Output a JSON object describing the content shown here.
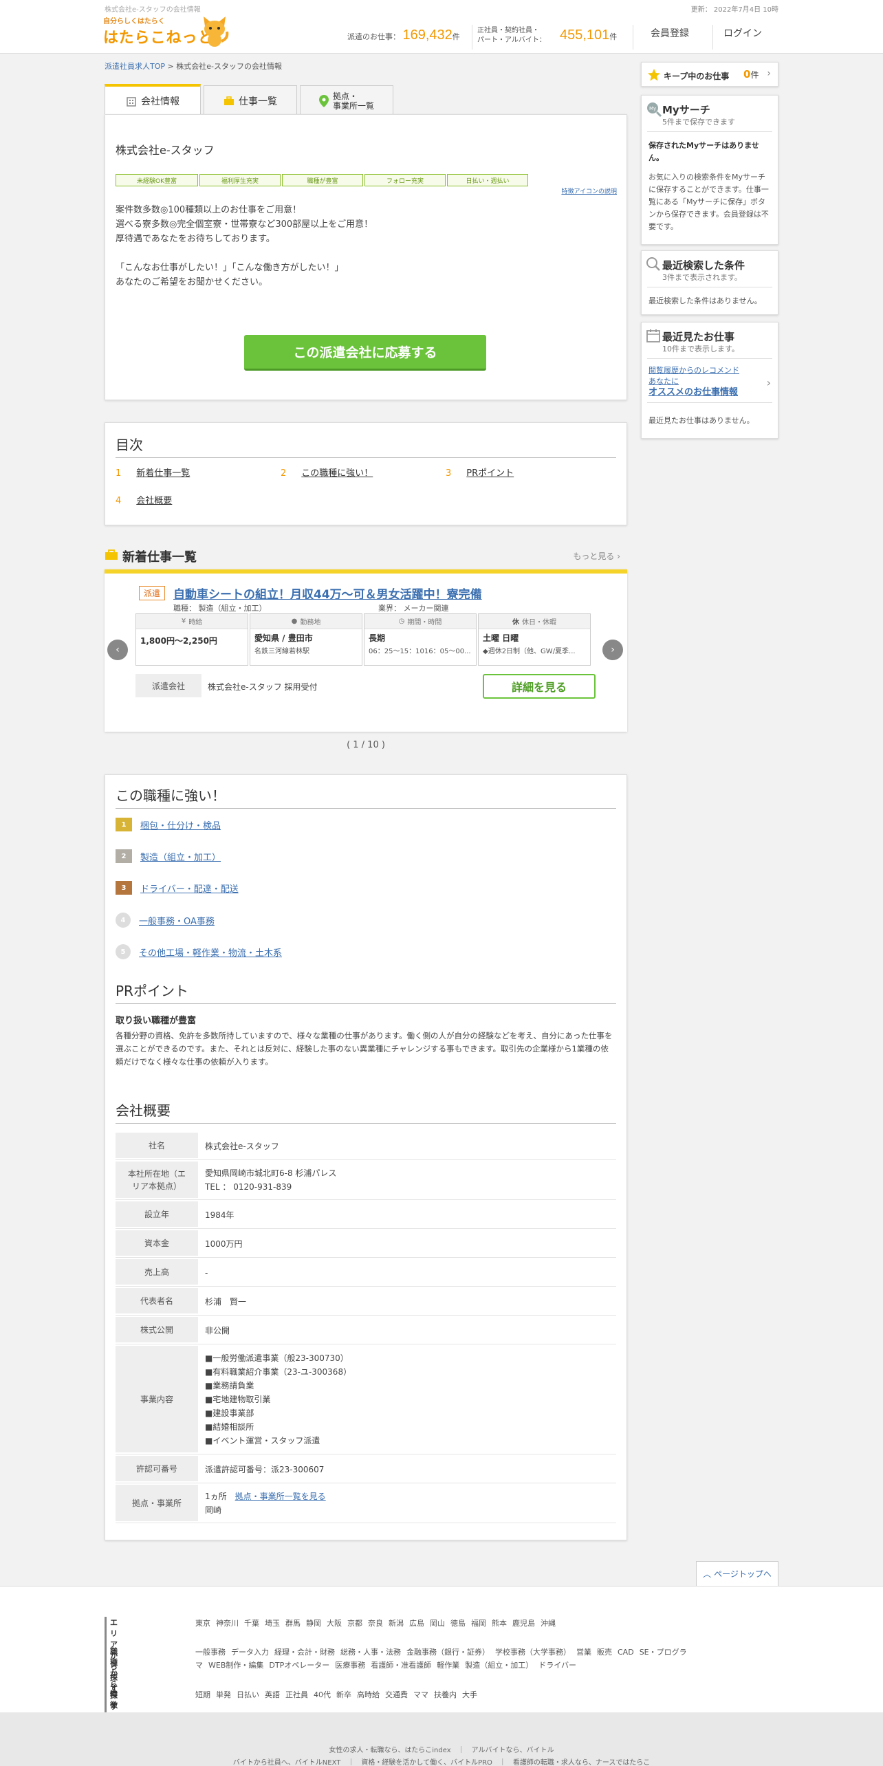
{
  "header": {
    "tagline": "株式会社e-スタッフの会社情報",
    "updated": "更新： 2022年7月4日 10時",
    "logo_small": "自分らしくはたらく",
    "logo_main": "はたらこねっと",
    "haken_label": "派遣のお仕事：",
    "haken_count": "169,432",
    "haken_unit": "件",
    "other_label1": "正社員・契約社員・",
    "other_label2": "パート・アルバイト：",
    "other_count": "455,101",
    "other_unit": "件",
    "register": "会員登録",
    "login": "ログイン"
  },
  "breadcrumb": {
    "home": "派遣社員求人TOP",
    "sep": " > ",
    "company": "株式会社e-スタッフの会社情報"
  },
  "tabs": {
    "company_info": "会社情報",
    "jobs": "仕事一覧",
    "locations_1": "拠点・",
    "locations_2": "事業所一覧"
  },
  "company": {
    "name": "株式会社e-スタッフ",
    "badges": [
      "未経験OK豊富",
      "福利厚生充実",
      "職種が豊富",
      "フォロー充実",
      "日払い・週払い"
    ],
    "badge_help": "特徴アイコンの説明",
    "intro": [
      "案件数多数◎100種類以上のお仕事をご用意！",
      "選べる寮多数◎完全個室寮・世帯寮など300部屋以上をご用意！",
      "厚待遇であなたをお待ちしております。",
      "",
      "「こんなお仕事がしたい！」「こんな働き方がしたい！」",
      "あなたのご希望をお聞かせください。"
    ],
    "apply": "この派遣会社に応募する"
  },
  "toc": {
    "title": "目次",
    "items": [
      {
        "num": "1",
        "label": "新着仕事一覧"
      },
      {
        "num": "2",
        "label": "この職種に強い！"
      },
      {
        "num": "3",
        "label": "PRポイント"
      },
      {
        "num": "4",
        "label": "会社概要"
      }
    ]
  },
  "new_jobs": {
    "title": "新着仕事一覧",
    "more": "もっと見る",
    "tag": "派遣",
    "job_title": "自動車シートの組立！月収44万～可＆男女活躍中！寮完備",
    "category": "職種： 製造（組立・加工）",
    "industry": "業界： メーカー関連",
    "cells": [
      {
        "head": "時給",
        "main": "1,800円～2,250円",
        "sub": ""
      },
      {
        "head": "勤務地",
        "main": "愛知県 / 豊田市",
        "sub": "名鉄三河線若林駅"
      },
      {
        "head": "期間・時間",
        "main": "長期",
        "sub": "06：25～15：1016：05～00..."
      },
      {
        "head": "休日・休暇",
        "main": "土曜 日曜",
        "sub": "◆週休2日制（他、GW/夏季..."
      }
    ],
    "agency_label": "派遣会社",
    "agency_name": "株式会社e-スタッフ 採用受付",
    "detail": "詳細を見る",
    "pager": "( 1 / 10 )"
  },
  "strong": {
    "title": "この職種に強い！",
    "items": [
      {
        "rank": "1",
        "label": "梱包・仕分け・検品"
      },
      {
        "rank": "2",
        "label": "製造（組立・加工）"
      },
      {
        "rank": "3",
        "label": "ドライバー・配達・配送"
      },
      {
        "rank": "4",
        "label": "一般事務・OA事務"
      },
      {
        "rank": "5",
        "label": "その他工場・軽作業・物流・土木系"
      }
    ]
  },
  "pr": {
    "title": "PRポイント",
    "subtitle": "取り扱い職種が豊富",
    "text": "各種分野の資格、免許を多数所持していますので、様々な業種の仕事があります。働く側の人が自分の経験などを考え、自分にあった仕事を選ぶことができるのです。また、それとは反対に、経験した事のない異業種にチャレンジする事もできます。取引先の企業様から1業種の依頼だけでなく様々な仕事の依頼が入ります。"
  },
  "overview": {
    "title": "会社概要",
    "rows": [
      {
        "label": "社名",
        "value": [
          "株式会社e-スタッフ"
        ]
      },
      {
        "label": "本社所在地（エリア本拠点）",
        "value": [
          "愛知県岡崎市城北町6-8 杉浦パレス",
          "TEL ： 0120-931-839"
        ]
      },
      {
        "label": "設立年",
        "value": [
          "1984年"
        ]
      },
      {
        "label": "資本金",
        "value": [
          "1000万円"
        ]
      },
      {
        "label": "売上高",
        "value": [
          "-"
        ]
      },
      {
        "label": "代表者名",
        "value": [
          "杉浦　賢一"
        ]
      },
      {
        "label": "株式公開",
        "value": [
          "非公開"
        ]
      },
      {
        "label": "事業内容",
        "value": [
          "■一般労働派遣事業（般23-300730）",
          "■有料職業紹介事業（23-ユ-300368）",
          "■業務請負業",
          "■宅地建物取引業",
          "■建設事業部",
          "■結婚相談所",
          "■イベント運営・スタッフ派遣"
        ]
      },
      {
        "label": "許認可番号",
        "value": [
          "派遣許認可番号：派23-300607"
        ]
      },
      {
        "label": "拠点・事業所",
        "value": [
          "1ヵ所",
          "岡崎"
        ],
        "link": "拠点・事業所一覧を見る"
      }
    ]
  },
  "sidebar": {
    "keep_label": "キープ中のお仕事",
    "keep_count": "0",
    "keep_unit": "件",
    "mysearch_title": "Myサーチ",
    "mysearch_sub": "5件まで保存できます",
    "mysearch_empty": "保存されたMyサーチはありません。",
    "mysearch_desc": "お気に入りの検索条件をMyサーチに保存することができます。仕事一覧にある「Myサーチに保存」ボタンから保存できます。会員登録は不要です。",
    "recent_search_title": "最近検索した条件",
    "recent_search_sub": "3件まで表示されます。",
    "recent_search_empty": "最近検索した条件はありません。",
    "recent_jobs_title": "最近見たお仕事",
    "recent_jobs_sub": "10件まで表示します。",
    "recommend_1": "閲覧履歴からのレコメンド",
    "recommend_2": "あなたに",
    "recommend_3": "オススメのお仕事情報",
    "recent_jobs_empty": "最近見たお仕事はありません。"
  },
  "pagetop": "ページトップへ",
  "footer": {
    "area_label": "エリアから探す",
    "areas": [
      "東京",
      "神奈川",
      "千葉",
      "埼玉",
      "群馬",
      "静岡",
      "大阪",
      "京都",
      "奈良",
      "新潟",
      "広島",
      "岡山",
      "徳島",
      "福岡",
      "熊本",
      "鹿児島",
      "沖縄"
    ],
    "job_label": "職種から探す",
    "jobs": [
      "一般事務",
      "データ入力",
      "経理・会計・財務",
      "総務・人事・法務",
      "金融事務（銀行・証券）",
      "学校事務（大学事務）",
      "営業",
      "販売",
      "CAD",
      "SE・プログラマ",
      "WEB制作・編集",
      "DTPオペレーター",
      "医療事務",
      "看護師・准看護師",
      "軽作業",
      "製造（組立・加工）",
      "ドライバー"
    ],
    "feature_label": "特徴から探す",
    "features": [
      "短期",
      "単発",
      "日払い",
      "英語",
      "正社員",
      "40代",
      "新卒",
      "高時給",
      "交通費",
      "ママ",
      "扶養内",
      "大手"
    ],
    "bottom_1": "女性の求人・転職なら、はたらこindex　｜　アルバイトなら、バイトル",
    "bottom_2": "バイトから社員へ、バイトルNEXT　｜　資格・経験を活かして働く、バイトルPRO　｜　看護師の転職・求人なら、ナースではたらこ"
  },
  "colors": {
    "accent": "#f39800",
    "green": "#6ac33b",
    "link": "#3b6fb0",
    "yellow": "#f5c400"
  }
}
